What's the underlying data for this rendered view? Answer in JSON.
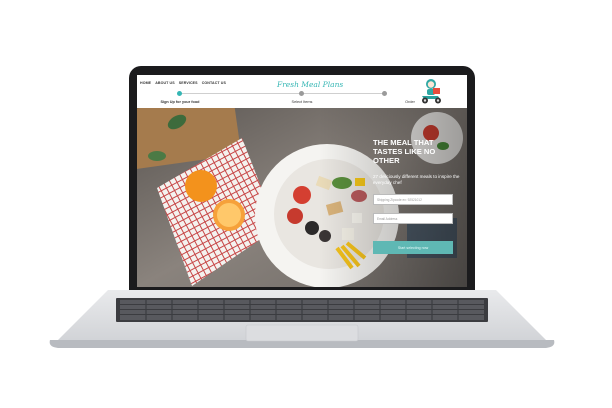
{
  "nav": {
    "items": [
      {
        "label": "HOME"
      },
      {
        "label": "ABOUT US"
      },
      {
        "label": "SERVICES"
      },
      {
        "label": "CONTACT US"
      }
    ]
  },
  "brand": {
    "logo_text": "Fresh Meal Plans",
    "accent": "#35b6b4"
  },
  "steps": [
    {
      "label": "Sign Up for your food",
      "active": true
    },
    {
      "label": "Select Items",
      "active": false
    },
    {
      "label": "Order",
      "active": false
    }
  ],
  "hero": {
    "title": "THE MEAL THAT TASTES LIKE NO OTHER",
    "subtitle": "27 deliciously different meals to inspire the everyday chef",
    "zip_placeholder": "Shipping Zipcode ex: 92521012",
    "email_placeholder": "Email Address",
    "cta_label": "Start selecting now"
  }
}
